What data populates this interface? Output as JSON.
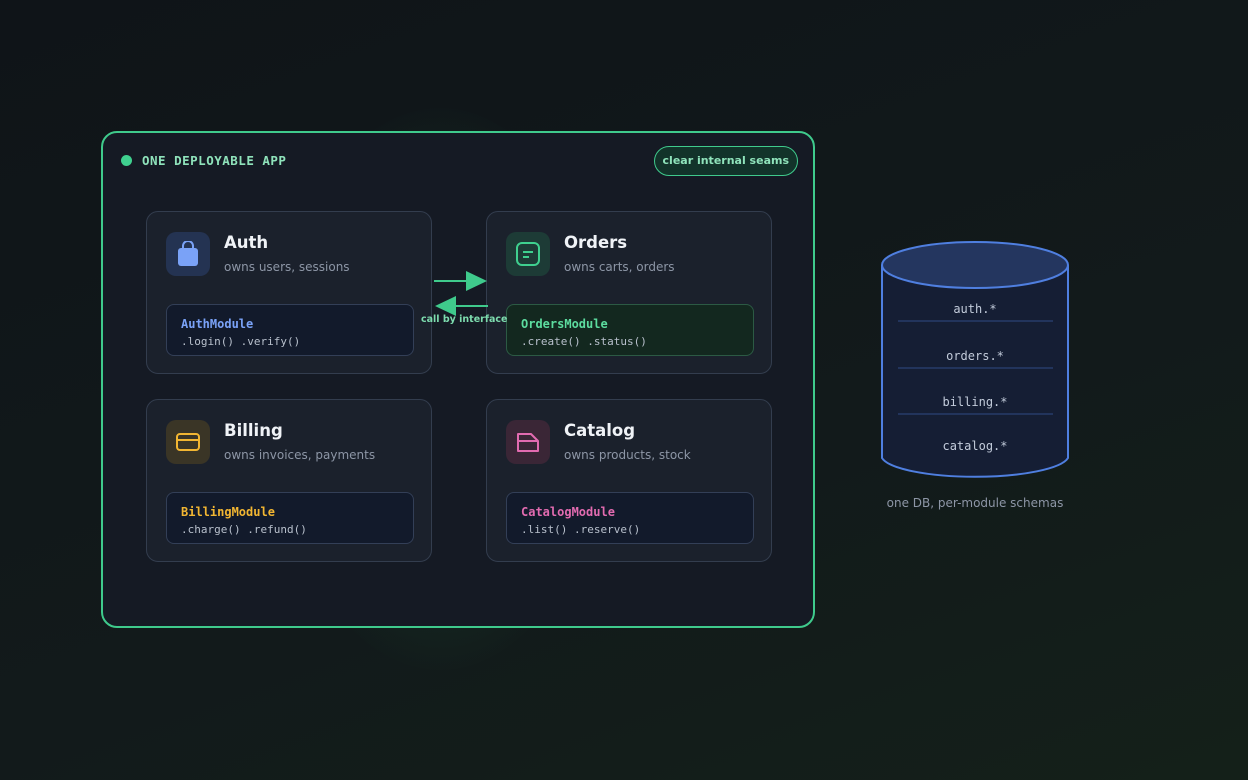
{
  "app": {
    "title": "ONE DEPLOYABLE APP",
    "badge": "clear internal seams"
  },
  "modules": [
    {
      "name": "Auth",
      "desc": "owns users, sessions",
      "class_name": "AuthModule",
      "methods": ".login() .verify()",
      "icon": "lock-icon",
      "color": "#7aa2f7"
    },
    {
      "name": "Orders",
      "desc": "owns carts, orders",
      "class_name": "OrdersModule",
      "methods": ".create() .status()",
      "icon": "receipt-icon",
      "color": "#3fd08f"
    },
    {
      "name": "Billing",
      "desc": "owns invoices, payments",
      "class_name": "BillingModule",
      "methods": ".charge() .refund()",
      "icon": "credit-card-icon",
      "color": "#f2b632"
    },
    {
      "name": "Catalog",
      "desc": "owns products, stock",
      "class_name": "CatalogModule",
      "methods": ".list() .reserve()",
      "icon": "box-icon",
      "color": "#e26bb0"
    }
  ],
  "connection": {
    "label": "call by interface"
  },
  "database": {
    "schemas": [
      "auth.*",
      "orders.*",
      "billing.*",
      "catalog.*"
    ],
    "caption": "one DB, per-module schemas"
  },
  "colors": {
    "accent": "#3fca8c",
    "db": "#4f7fe0"
  }
}
